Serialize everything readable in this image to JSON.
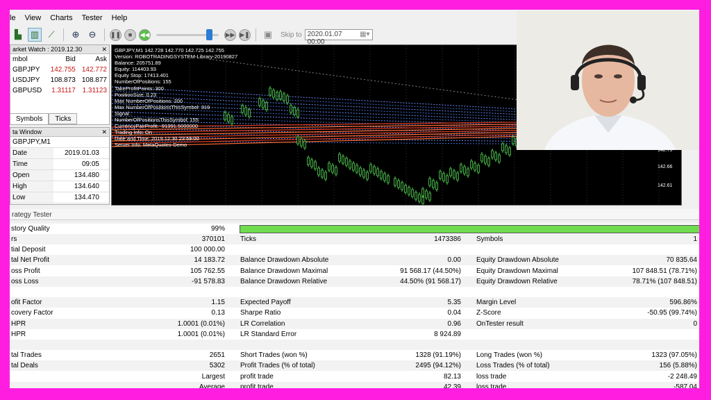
{
  "menu": [
    "le",
    "View",
    "Charts",
    "Tester",
    "Help"
  ],
  "toolbar": {
    "skip_label": "Skip to",
    "date_value": "2020.01.07 00:00"
  },
  "market_watch": {
    "title": "arket Watch : 2019.12.30",
    "headers": [
      "mbol",
      "Bid",
      "Ask"
    ],
    "rows": [
      {
        "symbol": "GBPJPY",
        "bid": "142.755",
        "ask": "142.772"
      },
      {
        "symbol": "USDJPY",
        "bid": "108.873",
        "ask": "108.877"
      },
      {
        "symbol": "GBPUSD",
        "bid": "1.31117",
        "ask": "1.31123"
      }
    ],
    "tabs": [
      "Symbols",
      "Ticks"
    ]
  },
  "data_window": {
    "title": "ta Window",
    "symbol": "GBPJPY,M1",
    "rows": [
      {
        "k": "Date",
        "v": "2019.01.03"
      },
      {
        "k": "Time",
        "v": "09:05"
      },
      {
        "k": "Open",
        "v": "134.480"
      },
      {
        "k": "High",
        "v": "134.640"
      },
      {
        "k": "Low",
        "v": "134.470"
      }
    ]
  },
  "chart": {
    "info": [
      "GBPJPY,M1  142.728 142.770 142.725 142.755",
      "Version: ROBOTRADINGSYSTEM-Library-20190827",
      "Balance: 205751.89",
      "Equity: 114403.93",
      "Equity Stop: 17413.401",
      "NumberOfPositions: 155",
      "TakeProfitPoints: 300",
      "PositionSize: 0.23",
      "Max NumberOfPositions: 200",
      "Max NumberOfPositionsThisSymbol: 319",
      "Signal :",
      "NumberOfPositionsThisSymbol: 155",
      "CurrencyPairProfit: -91391.5000000",
      "Trading Info: On",
      "Date and Time: 2019.12.30 23:59:00",
      "Server Info: MetaQuotes-Demo"
    ],
    "yticks": [
      "142.75",
      "142.66",
      "142.61"
    ]
  },
  "tester": {
    "title": "rategy Tester",
    "quality_label": "story Quality",
    "quality_value": "99%",
    "quality_fraction": 0.99,
    "rows": [
      [
        "rs",
        "370101",
        "Ticks",
        "1473386",
        "Symbols",
        "1"
      ],
      [
        "tial Deposit",
        "100 000.00",
        "",
        "",
        "",
        ""
      ],
      [
        "tal Net Profit",
        "14 183.72",
        "Balance Drawdown Absolute",
        "0.00",
        "Equity Drawdown Absolute",
        "70 835.64"
      ],
      [
        "oss Profit",
        "105 762.55",
        "Balance Drawdown Maximal",
        "91 568.17 (44.50%)",
        "Equity Drawdown Maximal",
        "107 848.51 (78.71%)"
      ],
      [
        "oss Loss",
        "-91 578.83",
        "Balance Drawdown Relative",
        "44.50% (91 568.17)",
        "Equity Drawdown Relative",
        "78.71% (107 848.51)"
      ],
      [
        "",
        "",
        "",
        "",
        "",
        ""
      ],
      [
        "ofit Factor",
        "1.15",
        "Expected Payoff",
        "5.35",
        "Margin Level",
        "596.86%"
      ],
      [
        "covery Factor",
        "0.13",
        "Sharpe Ratio",
        "0.04",
        "Z-Score",
        "-50.95 (99.74%)"
      ],
      [
        "HPR",
        "1.0001 (0.01%)",
        "LR Correlation",
        "0.96",
        "OnTester result",
        "0"
      ],
      [
        "HPR",
        "1.0001 (0.01%)",
        "LR Standard Error",
        "8 924.89",
        "",
        ""
      ],
      [
        "",
        "",
        "",
        "",
        "",
        ""
      ],
      [
        "tal Trades",
        "2651",
        "Short Trades (won %)",
        "1328 (91.19%)",
        "Long Trades (won %)",
        "1323 (97.05%)"
      ],
      [
        "tal Deals",
        "5302",
        "Profit Trades (% of total)",
        "2495 (94.12%)",
        "Loss Trades (% of total)",
        "156 (5.88%)"
      ],
      [
        "",
        "Largest",
        "profit trade",
        "82.13",
        "loss trade",
        "-2 248.49"
      ],
      [
        "",
        "Average",
        "profit trade",
        "42.39",
        "loss trade",
        "-587.04"
      ]
    ]
  }
}
